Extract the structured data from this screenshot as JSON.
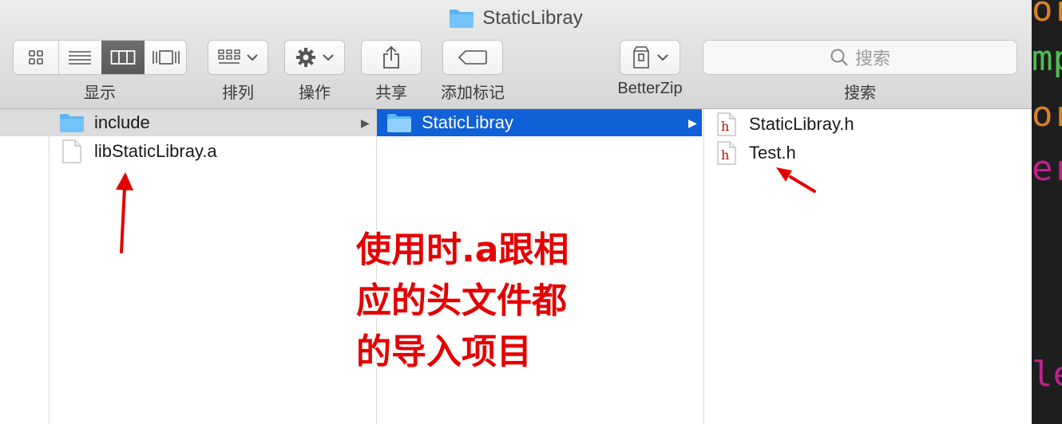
{
  "window": {
    "title": "StaticLibray"
  },
  "toolbar": {
    "view_label": "显示",
    "arrange_label": "排列",
    "action_label": "操作",
    "share_label": "共享",
    "tags_label": "添加标记",
    "betterzip_label": "BetterZip",
    "search_label": "搜索",
    "search_placeholder": "搜索"
  },
  "columns": {
    "col1": {
      "items": [
        {
          "label": "include"
        },
        {
          "label": "libStaticLibray.a"
        }
      ]
    },
    "col2": {
      "items": [
        {
          "label": "StaticLibray"
        }
      ]
    },
    "col3": {
      "items": [
        {
          "label": "StaticLibray.h"
        },
        {
          "label": "Test.h"
        }
      ]
    }
  },
  "annotation": {
    "lines": [
      "使用时.a跟相",
      "应的头文件都",
      "的导入项目"
    ]
  },
  "code_strip": {
    "fragments": [
      "or",
      "mp",
      "or",
      "er",
      "le"
    ]
  },
  "colors": {
    "selection_blue": "#1060d8",
    "annotation_red": "#e50000",
    "folder_blue": "#5fb6f4"
  }
}
